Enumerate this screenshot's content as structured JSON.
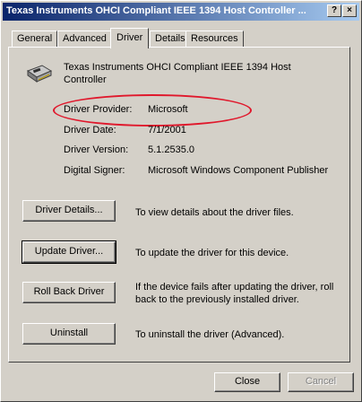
{
  "window": {
    "title": "Texas Instruments OHCI Compliant IEEE 1394 Host Controller ...",
    "help_label": "?",
    "close_label": "×"
  },
  "tabs": [
    {
      "label": "General"
    },
    {
      "label": "Advanced"
    },
    {
      "label": "Driver"
    },
    {
      "label": "Details"
    },
    {
      "label": "Resources"
    }
  ],
  "device": {
    "name": "Texas Instruments OHCI Compliant IEEE 1394 Host Controller"
  },
  "driver_info": {
    "provider_label": "Driver Provider:",
    "provider_value": "Microsoft",
    "date_label": "Driver Date:",
    "date_value": "7/1/2001",
    "version_label": "Driver Version:",
    "version_value": "5.1.2535.0",
    "signer_label": "Digital Signer:",
    "signer_value": "Microsoft Windows Component Publisher"
  },
  "actions": [
    {
      "button": "Driver Details...",
      "description": "To view details about the driver files."
    },
    {
      "button": "Update Driver...",
      "description": "To update the driver for this device."
    },
    {
      "button": "Roll Back Driver",
      "description": "If the device fails after updating the driver, roll back to the previously installed driver."
    },
    {
      "button": "Uninstall",
      "description": "To uninstall the driver (Advanced)."
    }
  ],
  "footer": {
    "close_label": "Close",
    "cancel_label": "Cancel"
  },
  "colors": {
    "titlebar_start": "#0a246a",
    "titlebar_end": "#a6caf0",
    "callout": "#e0182c",
    "face": "#d4d0c8"
  }
}
